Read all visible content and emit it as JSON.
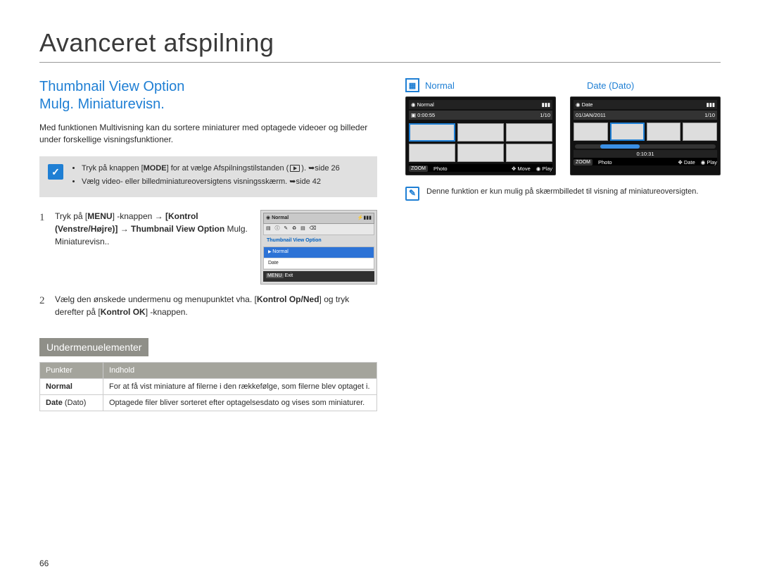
{
  "title": "Avanceret afspilning",
  "subtitle_line1": "Thumbnail View Option",
  "subtitle_line2": "Mulg. Miniaturevisn.",
  "intro": "Med funktionen Multivisning kan du sortere miniaturer med optagede videoer og billeder under forskellige visningsfunktioner.",
  "note_items": [
    "Tryk på knappen [MODE] for at vælge Afspilningstilstanden ( ▶ ). ➥side 26",
    "Vælg video- eller billedminiatureoversigtens visningsskærm. ➥side 42"
  ],
  "step1_a": "Tryk på [",
  "step1_menu": "MENU",
  "step1_b": "] -knappen → ",
  "step1_c": "[Kontrol (Venstre/Højre)]",
  "step1_d": " → ",
  "step1_e": "Thumbnail View Option",
  "step1_f": " Mulg. Miniaturevisn..",
  "step2_a": "Vælg den ønskede undermenu og menupunktet vha. [",
  "step2_b": "Kontrol Op/Ned",
  "step2_c": "] og tryk derefter på [",
  "step2_d": "Kontrol OK",
  "step2_e": "] -knappen.",
  "mini_screen": {
    "header": "Normal",
    "title": "Thumbnail View Option",
    "item_sel": "Normal",
    "item2": "Date",
    "footer_label": "MENU",
    "footer_text": "Exit"
  },
  "panel_head": "Undermenuelementer",
  "table": {
    "head_points": "Punkter",
    "head_content": "Indhold",
    "row1_k": "Normal",
    "row1_v": "For at få vist miniature af filerne i den rækkefølge, som filerne blev optaget i.",
    "row2_k": "Date",
    "row2_k_suffix": " (Dato)",
    "row2_v": "Optagede filer bliver sorteret efter optagelsesdato og vises som miniaturer."
  },
  "right": {
    "normal_label": "Normal",
    "date_label": "Date (Dato)",
    "lcd1": {
      "top": "Normal",
      "sub_left": "0:00:55",
      "sub_right": "1/10",
      "bot_zoom": "ZOOM",
      "bot_photo": "Photo",
      "bot_move": "Move",
      "bot_play": "Play"
    },
    "lcd2": {
      "top": "Date",
      "sub_left": "01/JAN/2011",
      "sub_right": "1/10",
      "time": "0:10:31",
      "bot_zoom": "ZOOM",
      "bot_photo": "Photo",
      "bot_date": "Date",
      "bot_play": "Play"
    },
    "note": "Denne funktion er kun mulig på skærmbilledet til visning af miniatureoversigten."
  },
  "page_number": "66"
}
